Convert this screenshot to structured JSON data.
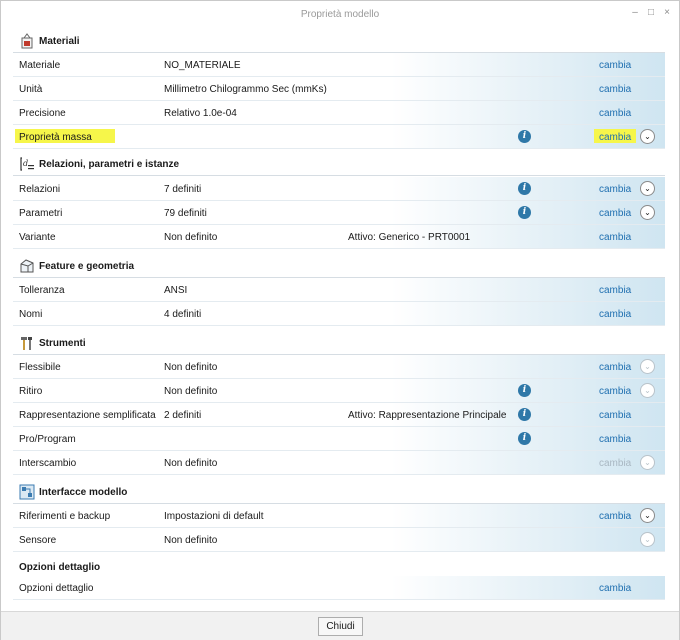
{
  "window": {
    "title": "Proprietà modello",
    "minimize_glyph": "–",
    "maximize_glyph": "□",
    "close_glyph": "×"
  },
  "highlight_color": "#f6f64a",
  "link_color": "#1f6fb0",
  "sections": {
    "materiali": {
      "title": "Materiali",
      "rows": {
        "materiale": {
          "label": "Materiale",
          "value": "NO_MATERIALE",
          "action": "cambia"
        },
        "unita": {
          "label": "Unità",
          "value": "Millimetro Chilogrammo Sec (mmKs)",
          "action": "cambia"
        },
        "precisione": {
          "label": "Precisione",
          "value": "Relativo 1.0e-04",
          "action": "cambia"
        },
        "massa": {
          "label": "Proprietà massa",
          "action": "cambia"
        }
      }
    },
    "relazioni": {
      "title": "Relazioni, parametri e istanze",
      "rows": {
        "relazioni": {
          "label": "Relazioni",
          "value": "7 definiti",
          "action": "cambia"
        },
        "parametri": {
          "label": "Parametri",
          "value": "79 definiti",
          "action": "cambia"
        },
        "variante": {
          "label": "Variante",
          "value": "Non definito",
          "extra": "Attivo: Generico - PRT0001",
          "action": "cambia"
        }
      }
    },
    "feature": {
      "title": "Feature e geometria",
      "rows": {
        "tolleranza": {
          "label": "Tolleranza",
          "value": "ANSI",
          "action": "cambia"
        },
        "nomi": {
          "label": "Nomi",
          "value": "4 definiti",
          "action": "cambia"
        }
      }
    },
    "strumenti": {
      "title": "Strumenti",
      "rows": {
        "flessibile": {
          "label": "Flessibile",
          "value": "Non definito",
          "action": "cambia"
        },
        "ritiro": {
          "label": "Ritiro",
          "value": "Non definito",
          "action": "cambia"
        },
        "rappresentazione": {
          "label": "Rappresentazione semplificata",
          "value": "2 definiti",
          "extra": "Attivo: Rappresentazione Principale",
          "action": "cambia"
        },
        "proprogram": {
          "label": "Pro/Program",
          "action": "cambia"
        },
        "interscambio": {
          "label": "Interscambio",
          "value": "Non definito",
          "action": "cambia"
        }
      }
    },
    "interfacce": {
      "title": "Interfacce modello",
      "rows": {
        "riferimenti": {
          "label": "Riferimenti e backup",
          "value": "Impostazioni di default",
          "action": "cambia"
        },
        "sensore": {
          "label": "Sensore",
          "value": "Non definito"
        }
      }
    },
    "opzioni": {
      "title": "Opzioni dettaglio",
      "rows": {
        "opzioni": {
          "label": "Opzioni dettaglio",
          "action": "cambia"
        }
      }
    }
  },
  "icons": {
    "info": "i",
    "expand": "⌄"
  },
  "footer": {
    "close_label": "Chiudi"
  }
}
